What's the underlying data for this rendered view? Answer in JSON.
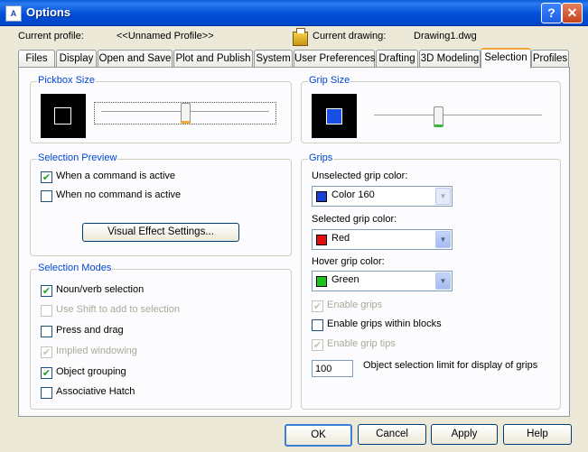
{
  "window": {
    "title": "Options",
    "app_icon_text": "A",
    "help_glyph": "?",
    "close_glyph": "✕"
  },
  "profile": {
    "current_profile_label": "Current profile:",
    "current_profile_value": "<<Unnamed Profile>>",
    "current_drawing_label": "Current drawing:",
    "current_drawing_value": "Drawing1.dwg",
    "drawing_icon": "drawing-file-icon"
  },
  "tabs": [
    {
      "label": "Files"
    },
    {
      "label": "Display"
    },
    {
      "label": "Open and Save"
    },
    {
      "label": "Plot and Publish"
    },
    {
      "label": "System"
    },
    {
      "label": "User Preferences"
    },
    {
      "label": "Drafting"
    },
    {
      "label": "3D Modeling"
    },
    {
      "label": "Selection",
      "active": true
    },
    {
      "label": "Profiles"
    }
  ],
  "pickbox": {
    "title": "Pickbox Size",
    "slider_position": 0.5
  },
  "grip_size": {
    "title": "Grip Size",
    "slider_position": 0.38
  },
  "selection_preview": {
    "title": "Selection Preview",
    "items": [
      {
        "label": "When a command is active",
        "checked": true,
        "enabled": true
      },
      {
        "label": "When no command is active",
        "checked": false,
        "enabled": true
      }
    ],
    "visual_effect_button": "Visual Effect Settings..."
  },
  "selection_modes": {
    "title": "Selection Modes",
    "items": [
      {
        "label": "Noun/verb selection",
        "checked": true,
        "enabled": true
      },
      {
        "label": "Use Shift to add to selection",
        "checked": false,
        "enabled": false
      },
      {
        "label": "Press and drag",
        "checked": false,
        "enabled": true
      },
      {
        "label": "Implied windowing",
        "checked": true,
        "enabled": false
      },
      {
        "label": "Object grouping",
        "checked": true,
        "enabled": true
      },
      {
        "label": "Associative Hatch",
        "checked": false,
        "enabled": true
      }
    ]
  },
  "grips": {
    "title": "Grips",
    "unselected_label": "Unselected grip color:",
    "unselected_value": "Color 160",
    "unselected_color": "#1a3fd6",
    "selected_label": "Selected grip color:",
    "selected_value": "Red",
    "selected_color": "#e01010",
    "hover_label": "Hover grip color:",
    "hover_value": "Green",
    "hover_color": "#18c818",
    "checks": [
      {
        "label": "Enable grips",
        "checked": true,
        "enabled": false
      },
      {
        "label": "Enable grips within blocks",
        "checked": false,
        "enabled": true
      },
      {
        "label": "Enable grip tips",
        "checked": true,
        "enabled": false
      }
    ],
    "limit_value": "100",
    "limit_label": "Object selection limit for display of grips"
  },
  "buttons": {
    "ok": "OK",
    "cancel": "Cancel",
    "apply": "Apply",
    "help": "Help"
  },
  "check_glyph": "✔"
}
